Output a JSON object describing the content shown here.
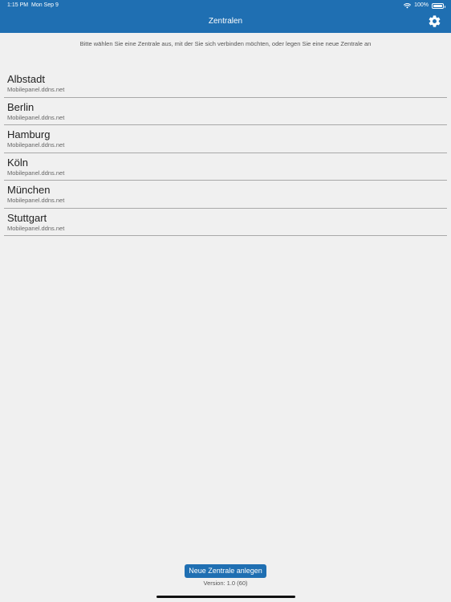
{
  "status_bar": {
    "time": "1:15 PM",
    "date": "Mon Sep 9",
    "battery": "100%"
  },
  "nav": {
    "title": "Zentralen",
    "settings_icon": "gear-icon"
  },
  "instruction": "Bitte wählen Sie eine Zentrale aus, mit der Sie sich verbinden möchten, oder legen Sie eine neue Zentrale an",
  "centrals": [
    {
      "name": "Albstadt",
      "host": "Mobilepanel.ddns.net"
    },
    {
      "name": "Berlin",
      "host": "Mobilepanel.ddns.net"
    },
    {
      "name": "Hamburg",
      "host": "Mobilepanel.ddns.net"
    },
    {
      "name": "Köln",
      "host": "Mobilepanel.ddns.net"
    },
    {
      "name": "München",
      "host": "Mobilepanel.ddns.net"
    },
    {
      "name": "Stuttgart",
      "host": "Mobilepanel.ddns.net"
    }
  ],
  "footer": {
    "new_button_label": "Neue Zentrale anlegen",
    "version": "Version: 1.0 (60)"
  },
  "colors": {
    "header_bg": "#1f6fb2",
    "page_bg": "#f0f0f0",
    "accent": "#1f6fb2"
  }
}
